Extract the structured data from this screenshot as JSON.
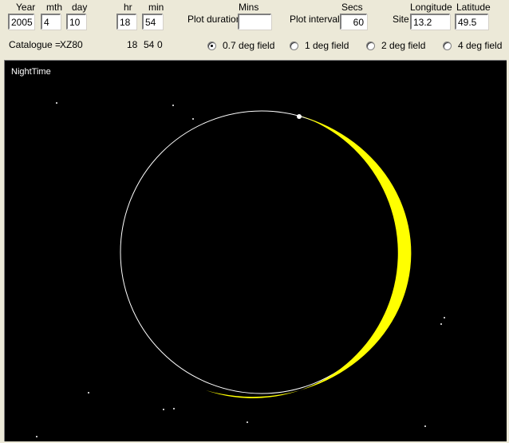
{
  "date": {
    "year_label": "Year",
    "month_label": "mth",
    "day_label": "day",
    "year": "2005",
    "month": "4",
    "day": "10"
  },
  "time": {
    "hour_label": "hr",
    "minute_label": "min",
    "hour": "18",
    "minute": "54"
  },
  "plot_duration": {
    "unit_label": "Mins",
    "label": "Plot duration",
    "value": ""
  },
  "plot_interval": {
    "unit_label": "Secs",
    "label": "Plot interval",
    "value": "60"
  },
  "site": {
    "label": "Site",
    "longitude_label": "Longitude",
    "latitude_label": "Latitude",
    "longitude": "13.2",
    "latitude": "49.5"
  },
  "catalogue": {
    "label": "Catalogue =",
    "value": "XZ80",
    "time_readout": {
      "hour": "18",
      "minute": "54",
      "second": "0"
    }
  },
  "field_options": [
    {
      "label": "0.7 deg field",
      "selected": true
    },
    {
      "label": "1 deg field",
      "selected": false
    },
    {
      "label": "2 deg field",
      "selected": false
    },
    {
      "label": "4 deg field",
      "selected": false
    }
  ],
  "sky": {
    "label": "NightTime",
    "background_color": "#000000",
    "moon_limb_color": "#ffffff",
    "crescent_color": "#ffff00",
    "star_color": "#ffffff"
  }
}
